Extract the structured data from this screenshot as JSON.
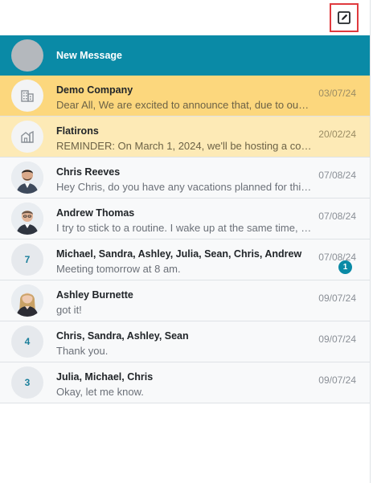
{
  "header": {
    "compose_icon": "edit-square-icon"
  },
  "new_message": {
    "label": "New Message"
  },
  "conversations": [
    {
      "name": "Demo Company",
      "preview": "Dear All, We are excited to announce that, due to our r...",
      "date": "03/07/24",
      "avatar": "building-icon"
    },
    {
      "name": "Flatirons",
      "preview": "REMINDER: On March 1, 2024, we'll be hosting a com...",
      "date": "20/02/24",
      "avatar": "house-building-icon"
    },
    {
      "name": "Chris Reeves",
      "preview": "Hey Chris, do you have any vacations planned for this...",
      "date": "07/08/24",
      "avatar": "person-photo"
    },
    {
      "name": "Andrew Thomas",
      "preview": "I try to stick to a routine. I wake up at the same time, t...",
      "date": "07/08/24",
      "avatar": "person-photo"
    },
    {
      "name": "Michael, Sandra, Ashley, Julia, Sean, Chris, Andrew",
      "preview": "Meeting tomorrow at 8 am.",
      "date": "07/08/24",
      "count": "7",
      "badge": "1"
    },
    {
      "name": "Ashley Burnette",
      "preview": "got it!",
      "date": "09/07/24",
      "avatar": "person-photo"
    },
    {
      "name": "Chris, Sandra, Ashley, Sean",
      "preview": "Thank you.",
      "date": "09/07/24",
      "count": "4"
    },
    {
      "name": "Julia, Michael, Chris",
      "preview": "Okay, let me know.",
      "date": "09/07/24",
      "count": "3"
    }
  ],
  "colors": {
    "accent": "#0a8aa6",
    "highlight_1": "#fcd77d",
    "highlight_2": "#fdeab6",
    "focus_border": "#e03a3e"
  }
}
